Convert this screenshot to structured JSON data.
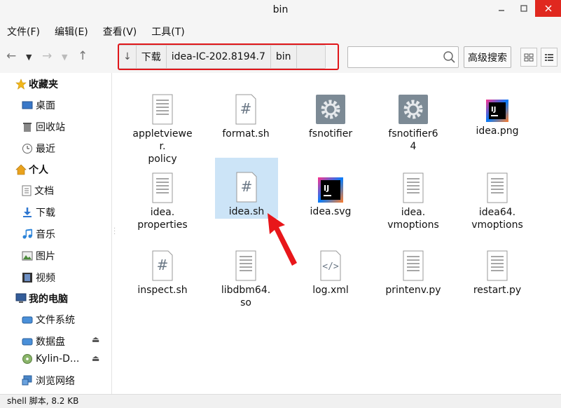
{
  "window": {
    "title": "bin"
  },
  "menu": [
    "文件(F)",
    "编辑(E)",
    "查看(V)",
    "工具(T)"
  ],
  "breadcrumb": [
    "下载",
    "idea-IC-202.8194.7",
    "bin"
  ],
  "search": {
    "value": "",
    "placeholder": ""
  },
  "advanced_search": "高级搜索",
  "sidebar": {
    "groups": [
      {
        "label": "收藏夹",
        "items": [
          "桌面",
          "回收站",
          "最近"
        ]
      },
      {
        "label": "个人",
        "items": [
          "文档",
          "下载",
          "音乐",
          "图片",
          "视频"
        ]
      },
      {
        "label": "我的电脑",
        "items": [
          "文件系统",
          "数据盘",
          "Kylin-D...",
          "浏览网络"
        ]
      }
    ]
  },
  "files": [
    {
      "name": "appletviewer.policy",
      "line1": "appletviewer.",
      "line2": "policy",
      "icon": "text-file-icon"
    },
    {
      "name": "format.sh",
      "line1": "format.sh",
      "line2": "",
      "icon": "shell-script-icon"
    },
    {
      "name": "fsnotifier",
      "line1": "fsnotifier",
      "line2": "",
      "icon": "executable-gear-icon"
    },
    {
      "name": "fsnotifier64",
      "line1": "fsnotifier6",
      "line2": "4",
      "icon": "executable-gear-icon"
    },
    {
      "name": "idea.png",
      "line1": "idea.png",
      "line2": "",
      "icon": "intellij-logo-icon"
    },
    {
      "name": "idea.properties",
      "line1": "idea.",
      "line2": "properties",
      "icon": "text-file-icon"
    },
    {
      "name": "idea.sh",
      "line1": "idea.sh",
      "line2": "",
      "icon": "shell-script-icon"
    },
    {
      "name": "idea.svg",
      "line1": "idea.svg",
      "line2": "",
      "icon": "intellij-logo-icon"
    },
    {
      "name": "idea.vmoptions",
      "line1": "idea.",
      "line2": "vmoptions",
      "icon": "text-file-icon"
    },
    {
      "name": "idea64.vmoptions",
      "line1": "idea64.",
      "line2": "vmoptions",
      "icon": "text-file-icon"
    },
    {
      "name": "inspect.sh",
      "line1": "inspect.sh",
      "line2": "",
      "icon": "shell-script-icon"
    },
    {
      "name": "libdbm64.so",
      "line1": "libdbm64.",
      "line2": "so",
      "icon": "text-file-icon"
    },
    {
      "name": "log.xml",
      "line1": "log.xml",
      "line2": "",
      "icon": "xml-file-icon"
    },
    {
      "name": "printenv.py",
      "line1": "printenv.py",
      "line2": "",
      "icon": "text-file-icon"
    },
    {
      "name": "restart.py",
      "line1": "restart.py",
      "line2": "",
      "icon": "text-file-icon"
    }
  ],
  "selected_file": "idea.sh",
  "status": "shell 脚本, 8.2 KB",
  "colors": {
    "selection": "#cce4f7",
    "annotation_red": "#e0161a",
    "close_button": "#e0281f"
  }
}
